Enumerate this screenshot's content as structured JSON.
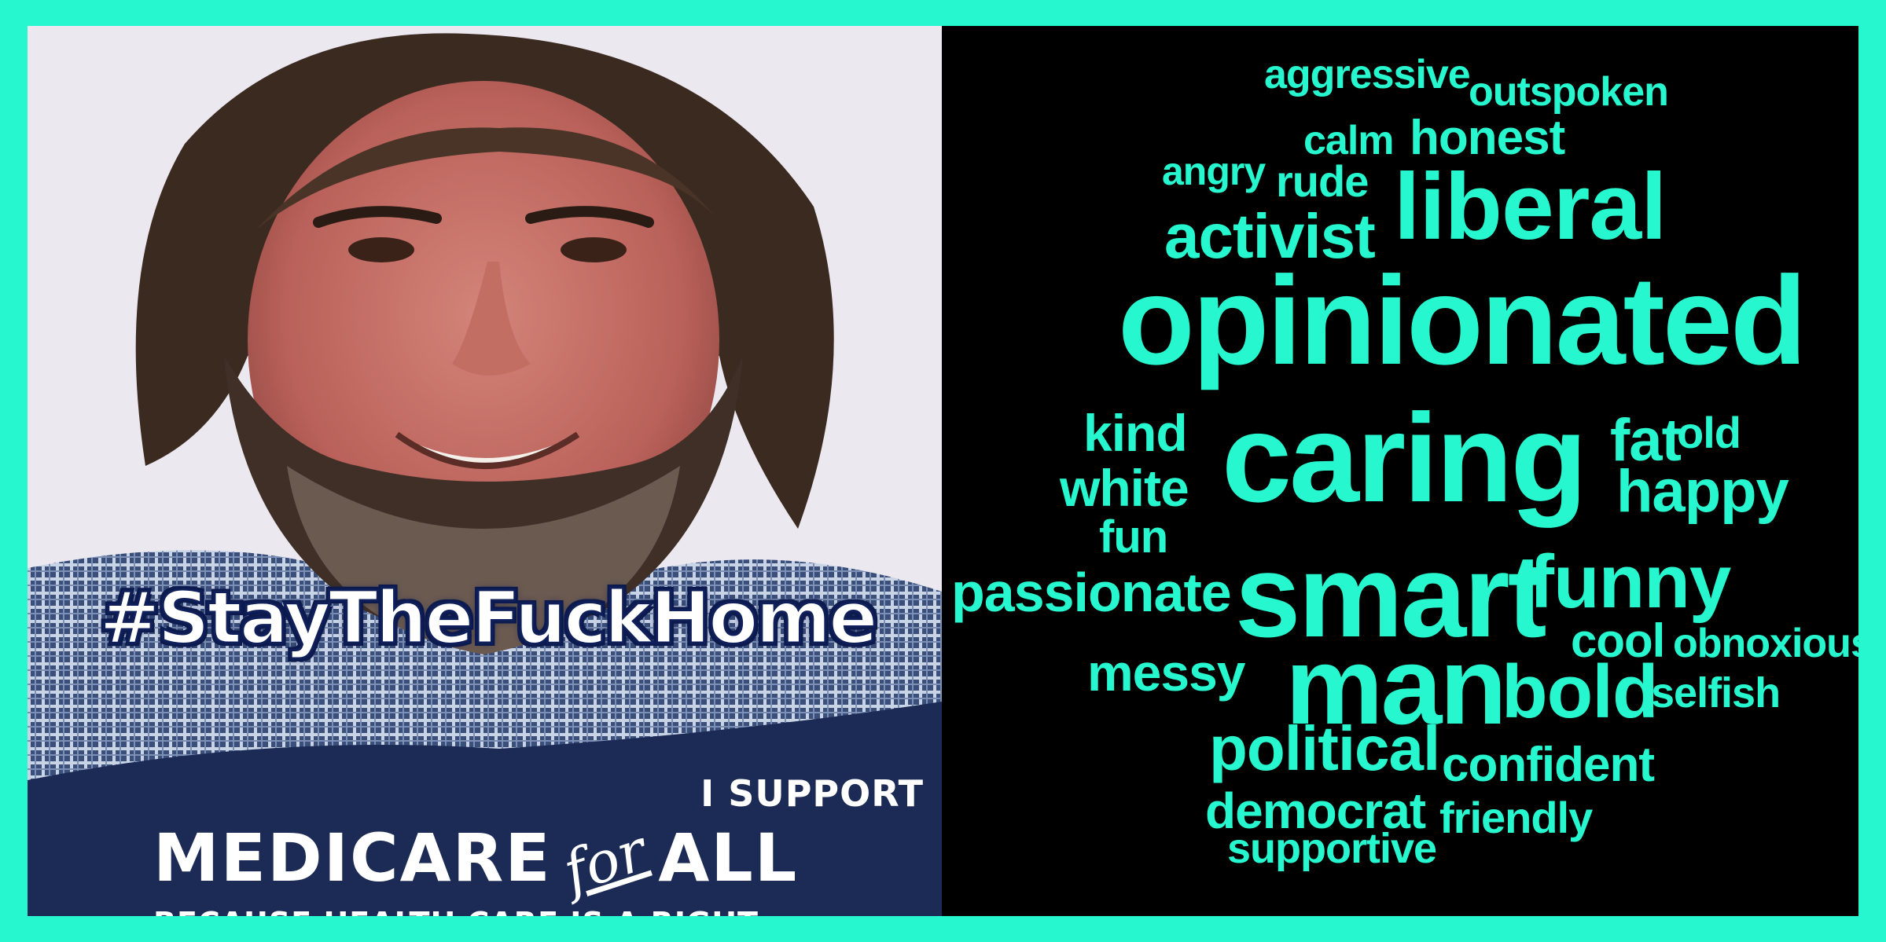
{
  "colors": {
    "frame": "#27f7ce",
    "cloud_background": "#000000",
    "word_color": "#27f7ce",
    "banner_blue": "#1c2b55"
  },
  "poster": {
    "hashtag": "#StayTheFuckHome",
    "support_line": "I SUPPORT",
    "medicare_word": "MEDICARE",
    "for_word": "for",
    "all_word": "ALL",
    "tagline": "BECAUSE HEALTH CARE IS A RIGHT."
  },
  "word_cloud": {
    "words": [
      "aggressive",
      "outspoken",
      "calm",
      "honest",
      "angry",
      "rude",
      "liberal",
      "activist",
      "opinionated",
      "kind",
      "caring",
      "fat",
      "old",
      "white",
      "happy",
      "fun",
      "passionate",
      "smart",
      "funny",
      "cool",
      "obnoxious",
      "messy",
      "man",
      "bold",
      "selfish",
      "political",
      "confident",
      "democrat",
      "friendly",
      "supportive"
    ]
  }
}
